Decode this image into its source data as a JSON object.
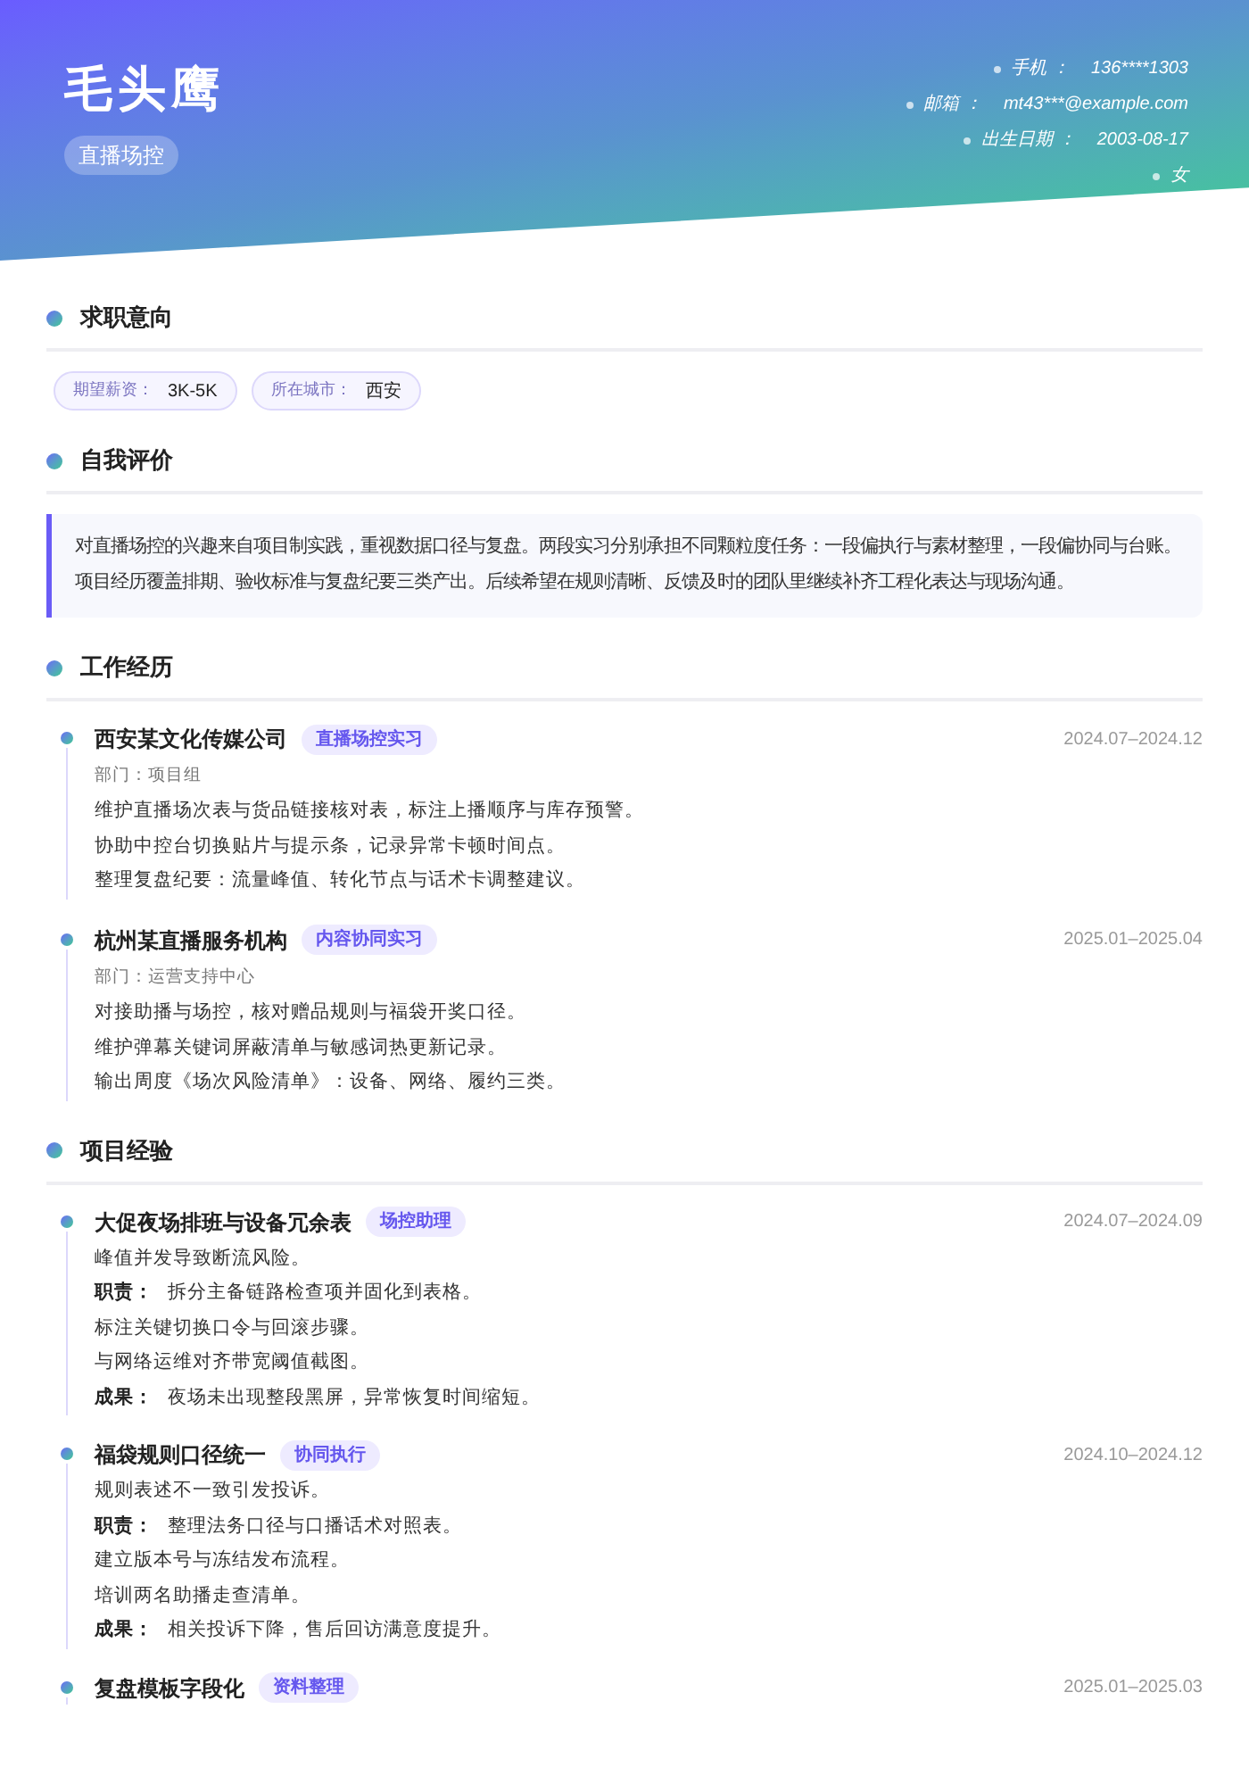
{
  "header": {
    "name": "毛头鹰",
    "role": "直播场控",
    "contacts": [
      {
        "label": "手机 ：",
        "value": "136****1303"
      },
      {
        "label": "邮箱 ：",
        "value": "mt43***@example.com"
      },
      {
        "label": "出生日期 ：",
        "value": "2003-08-17"
      },
      {
        "value": "女"
      }
    ]
  },
  "sections": [
    {
      "kind": "intent",
      "title": "求职意向",
      "chips": [
        {
          "label": "期望薪资：",
          "value": "3K-5K"
        },
        {
          "label": "所在城市：",
          "value": "西安"
        }
      ]
    },
    {
      "kind": "summary",
      "title": "自我评价",
      "text": "对直播场控的兴趣来自项目制实践，重视数据口径与复盘。两段实习分别承担不同颗粒度任务：一段偏执行与素材整理，一段偏协同与台账。项目经历覆盖排期、验收标准与复盘纪要三类产出。后续希望在规则清晰、反馈及时的团队里继续补齐工程化表达与现场沟通。"
    },
    {
      "kind": "work",
      "title": "工作经历",
      "items": [
        {
          "name": "西安某文化传媒公司",
          "tag": "直播场控实习",
          "date": "2024.07–2024.12",
          "dept": "部门：项目组",
          "lines": [
            "维护直播场次表与货品链接核对表，标注上播顺序与库存预警。",
            "协助中控台切换贴片与提示条，记录异常卡顿时间点。",
            "整理复盘纪要：流量峰值、转化节点与话术卡调整建议。"
          ]
        },
        {
          "name": "杭州某直播服务机构",
          "tag": "内容协同实习",
          "date": "2025.01–2025.04",
          "dept": "部门：运营支持中心",
          "lines": [
            "对接助播与场控，核对赠品规则与福袋开奖口径。",
            "维护弹幕关键词屏蔽清单与敏感词热更新记录。",
            "输出周度《场次风险清单》：设备、网络、履约三类。"
          ]
        }
      ]
    },
    {
      "kind": "projects",
      "title": "项目经验",
      "items": [
        {
          "name": "大促夜场排班与设备冗余表",
          "tag": "场控助理",
          "date": "2024.07–2024.09",
          "background": "峰值并发导致断流风险。",
          "duty_label": "职责：",
          "duties": [
            "拆分主备链路检查项并固化到表格。",
            "标注关键切换口令与回滚步骤。",
            "与网络运维对齐带宽阈值截图。"
          ],
          "result_label": "成果：",
          "result": "夜场未出现整段黑屏，异常恢复时间缩短。"
        },
        {
          "name": "福袋规则口径统一",
          "tag": "协同执行",
          "date": "2024.10–2024.12",
          "background": "规则表述不一致引发投诉。",
          "duty_label": "职责：",
          "duties": [
            "整理法务口径与口播话术对照表。",
            "建立版本号与冻结发布流程。",
            "培训两名助播走查清单。"
          ],
          "result_label": "成果：",
          "result": "相关投诉下降，售后回访满意度提升。"
        },
        {
          "name": "复盘模板字段化",
          "tag": "资料整理",
          "date": "2025.01–2025.03"
        }
      ]
    }
  ]
}
